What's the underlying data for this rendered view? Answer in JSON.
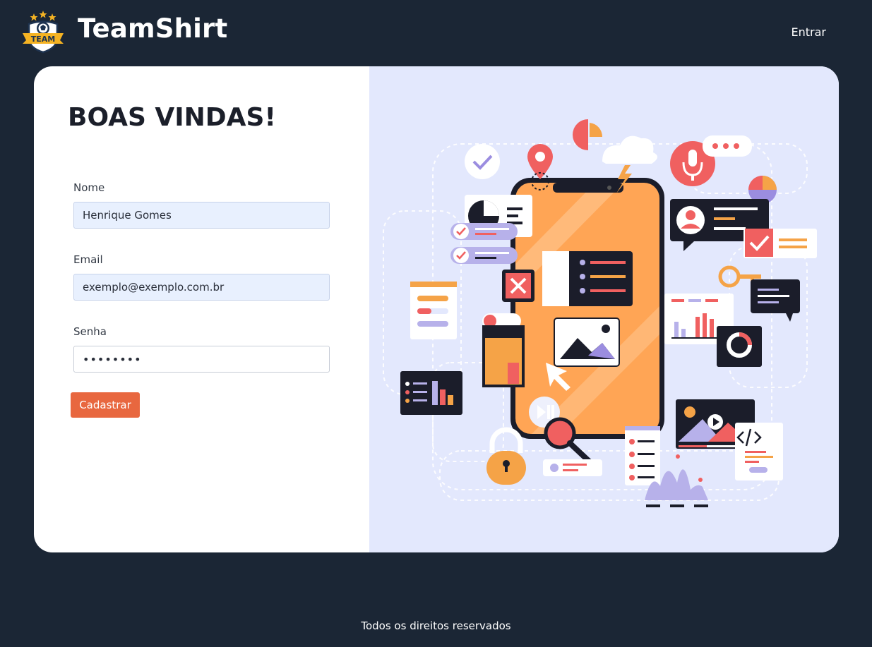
{
  "header": {
    "brand": "TeamShirt",
    "logo_text": "TEAM",
    "login_link": "Entrar"
  },
  "form": {
    "title": "BOAS VINDAS!",
    "name": {
      "label": "Nome",
      "value": "Henrique Gomes"
    },
    "email": {
      "label": "Email",
      "value": "exemplo@exemplo.com.br"
    },
    "password": {
      "label": "Senha",
      "value": "••••••••"
    },
    "submit_label": "Cadastrar"
  },
  "footer": {
    "text": "Todos os direitos reservados"
  },
  "colors": {
    "background": "#1b2635",
    "accent": "#e8673f",
    "illustration_bg": "#e3e8fd",
    "phone": "#ffa555"
  }
}
